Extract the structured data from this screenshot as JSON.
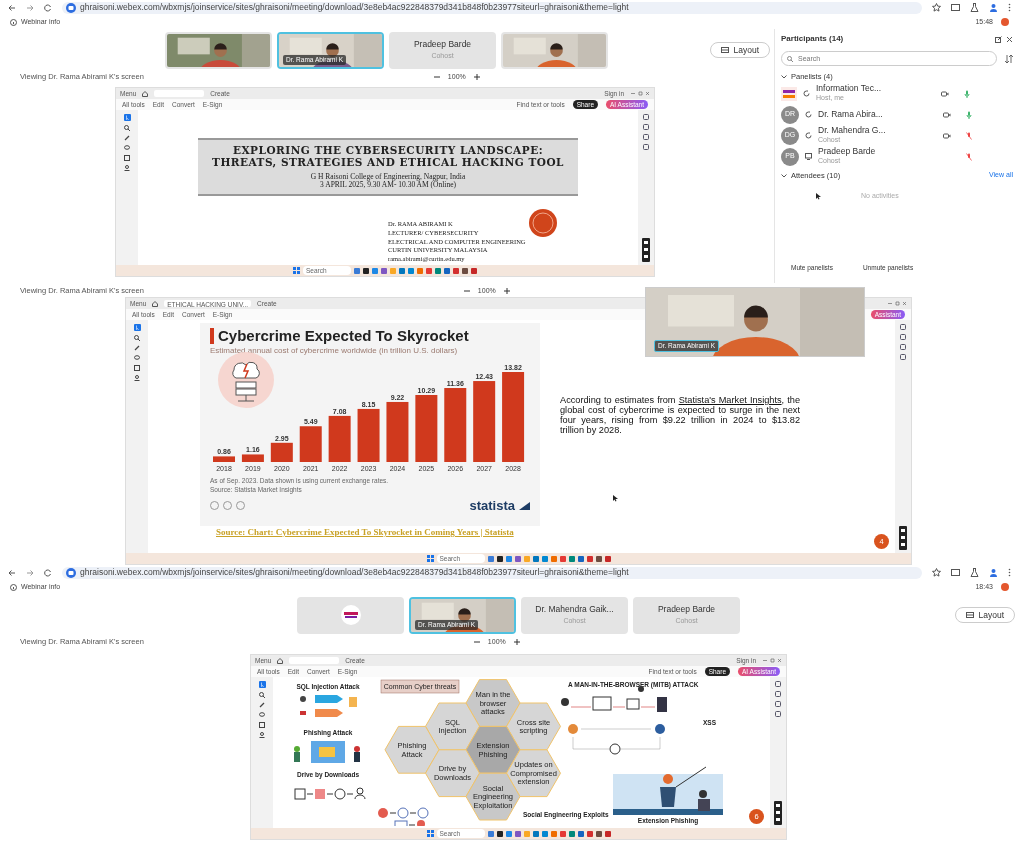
{
  "panels": [
    {
      "browser": {
        "url": "ghraisoni.webex.com/wbxmjs/joinservice/sites/ghraisoni/meeting/download/3e8eb4ac922848379d341b848f0b23977siteurl=ghraisoni&theme=light"
      },
      "webinar_info": "Webinar info",
      "time": "15:48",
      "tiles": [
        {
          "kind": "video",
          "selected": false
        },
        {
          "kind": "video",
          "name": "Dr. Rama Abirami K",
          "selected": true
        },
        {
          "kind": "name",
          "name": "Pradeep Barde",
          "role": "Cohost",
          "selected": false
        },
        {
          "kind": "video",
          "selected": false
        }
      ],
      "layout_button": "Layout",
      "viewing": "Viewing Dr. Rama Abirami K's screen",
      "zoom": "100%",
      "viewer": {
        "menu": "Menu",
        "create": "Create",
        "sign_in": "Sign in",
        "tools": [
          "All tools",
          "Edit",
          "Convert",
          "E-Sign"
        ],
        "find": "Find text or tools",
        "share": "Share",
        "assistant": "AI Assistant",
        "search": "Search"
      },
      "slide": {
        "kind": "title",
        "title": "EXPLORING THE CYBERSECURITY LANDSCAPE: THREATS, STRATEGIES AND ETHICAL HACKING TOOL",
        "venue": "G H Raisoni College of Engineering, Nagpur, India",
        "date": "3 APRIL 2025, 9.30 AM- 10.30 AM (Online)",
        "speaker": [
          "Dr. RAMA ABIRAMI K",
          "LECTURER/ CYBERSECURITY",
          "ELECTRICAL AND COMPUTER ENGINEERING",
          "CURTIN UNIVERSITY MALAYSIA",
          "rama.abirami@curtin.edu.my"
        ]
      },
      "participants": {
        "title": "Participants (14)",
        "placeholder": "Search",
        "panelists": "Panelists (4)",
        "people": [
          {
            "kind": "logo",
            "name": "Information Tec...",
            "role": "Host, me",
            "camera": true,
            "muted": false
          },
          {
            "kind": "initials",
            "initials": "DR",
            "name": "Dr. Rama Abira...",
            "camera": true,
            "muted": false
          },
          {
            "kind": "initials",
            "initials": "DG",
            "name": "Dr. Mahendra G...",
            "role": "Cohost",
            "camera": true,
            "muted": true
          },
          {
            "kind": "initials",
            "initials": "PB",
            "name": "Pradeep Barde",
            "role": "Cohost",
            "camera": false,
            "muted": true
          }
        ],
        "attendees": "Attendees (10)",
        "view_all": "View all",
        "empty": "No activities",
        "mute": "Mute panelists",
        "unmute": "Unmute panelists"
      }
    },
    {
      "viewing": "Viewing Dr. Rama Abirami K's screen",
      "zoom": "100%",
      "viewer": {
        "menu": "Menu",
        "tab": "ETHICAL HACKING UNIV...",
        "create": "Create",
        "tools": [
          "All tools",
          "Edit",
          "Convert",
          "E-Sign"
        ],
        "assistant": "Assistant",
        "search": "Search",
        "page": "4"
      },
      "floating_video": {
        "name": "Dr. Rama Abirami K"
      },
      "slide": {
        "kind": "chart",
        "title": "Cybercrime Expected To Skyrocket",
        "subtitle": "Estimated annual cost of cybercrime worldwide (in trillion U.S. dollars)",
        "chart_data": {
          "type": "bar",
          "categories": [
            "2018",
            "2019",
            "2020",
            "2021",
            "2022",
            "2023",
            "2024",
            "2025",
            "2026",
            "2027",
            "2028"
          ],
          "series": [
            {
              "color": "#d0391d",
              "values": [
                0.86,
                1.16,
                2.95,
                5.49,
                7.08,
                8.15,
                9.22,
                10.29,
                11.36,
                12.43,
                13.82
              ]
            }
          ],
          "data_labels": true
        },
        "value_labels": [
          "0.86",
          "1.16",
          "2.95",
          "5.49",
          "7.08",
          "8.15",
          "9.22",
          "10.29",
          "11.36",
          "12.43",
          "13.82"
        ],
        "note": "As of Sep. 2023. Data shown is using current exchange rates.",
        "source": "Source: Statista Market Insights",
        "brand": "statista",
        "link": "Source: Chart: Cybercrime Expected To Skyrocket in Coming Years | Statista",
        "paragraph": {
          "before": "According to estimates from",
          "link": "Statista's Market Insights",
          "after": ", the global cost of cybercrime is expected to surge in the next four years, rising from $9.22 trillion in 2024 to $13.82 trillion by 2028."
        }
      }
    },
    {
      "browser": {
        "url": "ghraisoni.webex.com/wbxmjs/joinservice/sites/ghraisoni/meeting/download/3e8eb4ac922848379d341b848f0b23977siteurl=ghraisoni&theme=light"
      },
      "webinar_info": "Webinar info",
      "time": "18:43",
      "tiles": [
        {
          "kind": "logo",
          "selected": false
        },
        {
          "kind": "video",
          "name": "Dr. Rama Abirami K",
          "selected": true
        },
        {
          "kind": "name",
          "name": "Dr. Mahendra Gaik...",
          "role": "Cohost",
          "selected": false
        },
        {
          "kind": "name",
          "name": "Pradeep Barde",
          "role": "Cohost",
          "selected": false
        }
      ],
      "layout_button": "Layout",
      "viewing": "Viewing Dr. Rama Abirami K's screen",
      "zoom": "100%",
      "viewer": {
        "menu": "Menu",
        "create": "Create",
        "sign_in": "Sign in",
        "tools": [
          "All tools",
          "Edit",
          "Convert",
          "E-Sign"
        ],
        "find": "Find text or tools",
        "share": "Share",
        "assistant": "AI Assistant",
        "search": "Search",
        "page": "6"
      },
      "slide": {
        "kind": "diagram",
        "heading": "Common Cyber threats",
        "labels": {
          "sql": "SQL Injection Attack",
          "phishing": "Phishing Attack",
          "drive": "Drive by Downloads",
          "mitb": "A MAN-IN-THE-BROWSER (MITB) ATTACK",
          "xss": "XSS",
          "social": "Social Engineering Exploits",
          "fishing": "Extension Phishing"
        },
        "hexagons": [
          "Man in the browser attacks",
          "SQL Injection",
          "Cross site scripting",
          "Phishing Attack",
          "Extension Phishing",
          "Drive by Downloads",
          "Updates on Compromised extension",
          "Social Engineering Exploitation"
        ]
      }
    }
  ]
}
